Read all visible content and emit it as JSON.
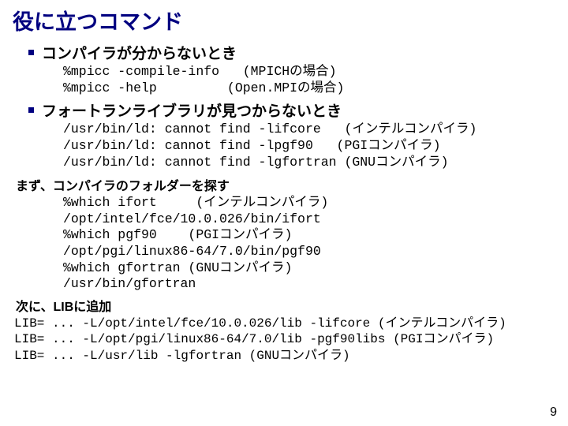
{
  "title": "役に立つコマンド",
  "b1": "コンパイラが分からないとき",
  "c1": "%mpicc -compile-info   (MPICHの場合)\n%mpicc -help         (Open.MPIの場合)",
  "b2": "フォートランライブラリが見つからないとき",
  "c2": "/usr/bin/ld: cannot find -lifcore   (インテルコンパイラ)\n/usr/bin/ld: cannot find -lpgf90   (PGIコンパイラ)\n/usr/bin/ld: cannot find -lgfortran (GNUコンパイラ)",
  "s1": "まず、コンパイラのフォルダーを探す",
  "c3": "%which ifort     (インテルコンパイラ)\n/opt/intel/fce/10.0.026/bin/ifort\n%which pgf90    (PGIコンパイラ)\n/opt/pgi/linux86-64/7.0/bin/pgf90\n%which gfortran (GNUコンパイラ)\n/usr/bin/gfortran",
  "s2": "次に、LIBに追加",
  "lib": "LIB= ... -L/opt/intel/fce/10.0.026/lib -lifcore (インテルコンパイラ)\nLIB= ... -L/opt/pgi/linux86-64/7.0/lib -pgf90libs (PGIコンパイラ)\nLIB= ... -L/usr/lib -lgfortran (GNUコンパイラ)",
  "page": "9"
}
